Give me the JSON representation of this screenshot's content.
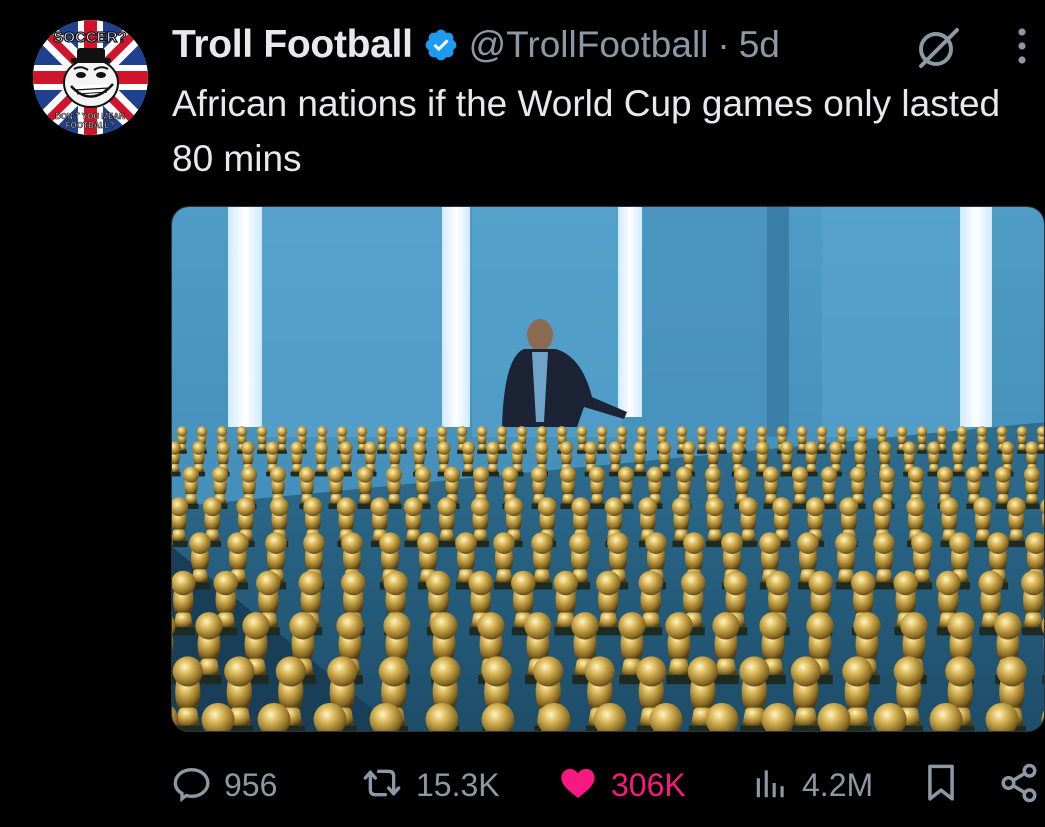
{
  "tweet": {
    "display_name": "Troll Football",
    "handle": "@TrollFootball",
    "separator": "·",
    "time": "5d",
    "text": "African nations if the World Cup games only lasted 80 mins"
  },
  "avatar": {
    "top_text": "SOCCER?",
    "bottom_text_1": "DON'T YOU MEAN",
    "bottom_text_2": "FOOTBALL?"
  },
  "actions": {
    "replies": "956",
    "reposts": "15.3K",
    "likes": "306K",
    "views": "4.2M"
  },
  "icons": {
    "verified": "verified-badge-icon",
    "grok": "grok-icon",
    "more": "more-vertical-icon",
    "reply": "reply-icon",
    "repost": "repost-icon",
    "like": "heart-icon",
    "views": "views-chart-icon",
    "bookmark": "bookmark-icon",
    "share": "share-icon"
  },
  "colors": {
    "background": "#000000",
    "text_primary": "#e7e9ea",
    "text_secondary": "#8b98a5",
    "verified_blue": "#1d9bf0",
    "like_pink": "#f91880"
  }
}
